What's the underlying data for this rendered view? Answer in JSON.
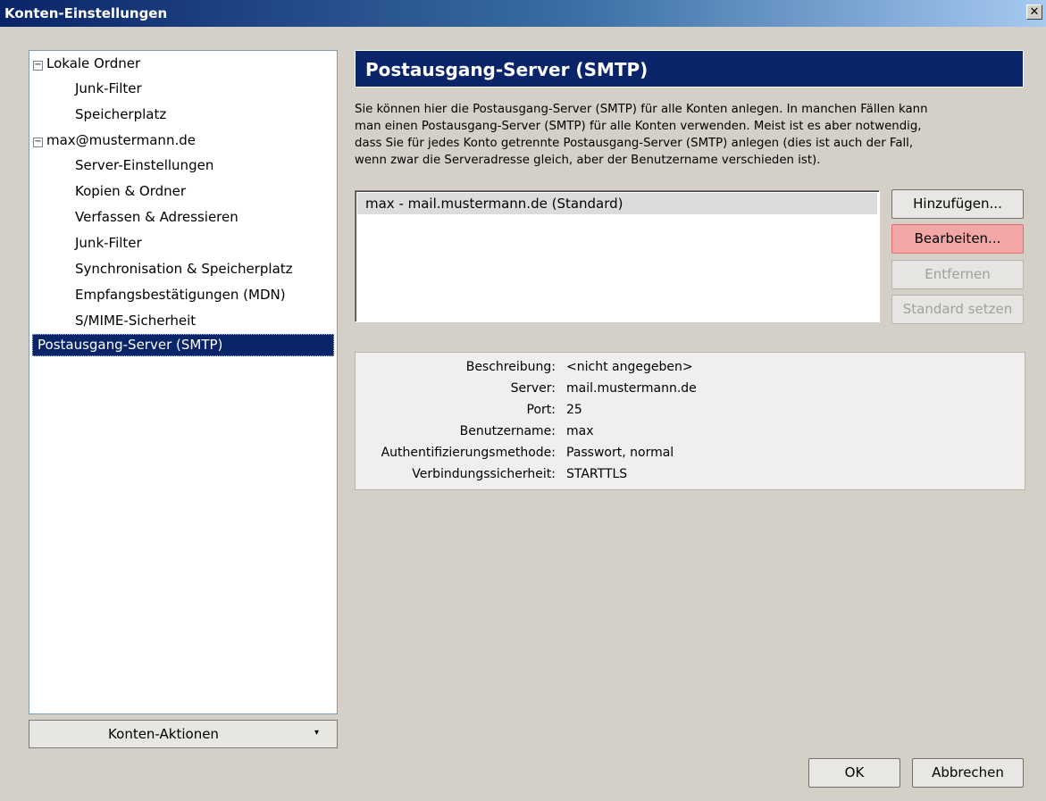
{
  "window": {
    "title": "Konten-Einstellungen",
    "close_glyph": "✕"
  },
  "tree": {
    "items": [
      {
        "label": "Lokale Ordner",
        "expander": "−",
        "level": 0
      },
      {
        "label": "Junk-Filter",
        "level": 1
      },
      {
        "label": "Speicherplatz",
        "level": 1
      },
      {
        "label": "max@mustermann.de",
        "expander": "−",
        "level": 0
      },
      {
        "label": "Server-Einstellungen",
        "level": 1
      },
      {
        "label": "Kopien & Ordner",
        "level": 1
      },
      {
        "label": "Verfassen & Adressieren",
        "level": 1
      },
      {
        "label": "Junk-Filter",
        "level": 1
      },
      {
        "label": "Synchronisation & Speicherplatz",
        "level": 1
      },
      {
        "label": "Empfangsbestätigungen (MDN)",
        "level": 1
      },
      {
        "label": "S/MIME-Sicherheit",
        "level": 1
      },
      {
        "label": "Postausgang-Server (SMTP)",
        "level": 0,
        "selected": true
      }
    ]
  },
  "account_actions": {
    "label": "Konten-Aktionen",
    "arrow": "▾"
  },
  "panel": {
    "title": "Postausgang-Server (SMTP)",
    "description": [
      "Sie können hier die Postausgang-Server (SMTP) für alle Konten anlegen. In manchen Fällen kann",
      "man einen Postausgang-Server (SMTP) für alle Konten verwenden. Meist ist es aber notwendig,",
      "dass Sie für jedes Konto getrennte Postausgang-Server (SMTP) anlegen (dies ist auch der Fall,",
      "wenn zwar die Serveradresse gleich, aber der Benutzername verschieden ist)."
    ],
    "servers": [
      "max - mail.mustermann.de (Standard)"
    ],
    "buttons": {
      "add": "Hinzufügen...",
      "edit": "Bearbeiten...",
      "remove": "Entfernen",
      "set_default": "Standard setzen"
    },
    "details": [
      {
        "key": "Beschreibung:",
        "value": "<nicht angegeben>"
      },
      {
        "key": "Server:",
        "value": "mail.mustermann.de"
      },
      {
        "key": "Port:",
        "value": "25"
      },
      {
        "key": "Benutzername:",
        "value": "max"
      },
      {
        "key": "Authentifizierungsmethode:",
        "value": "Passwort, normal"
      },
      {
        "key": "Verbindungssicherheit:",
        "value": "STARTTLS"
      }
    ]
  },
  "footer": {
    "ok": "OK",
    "cancel": "Abbrechen"
  }
}
